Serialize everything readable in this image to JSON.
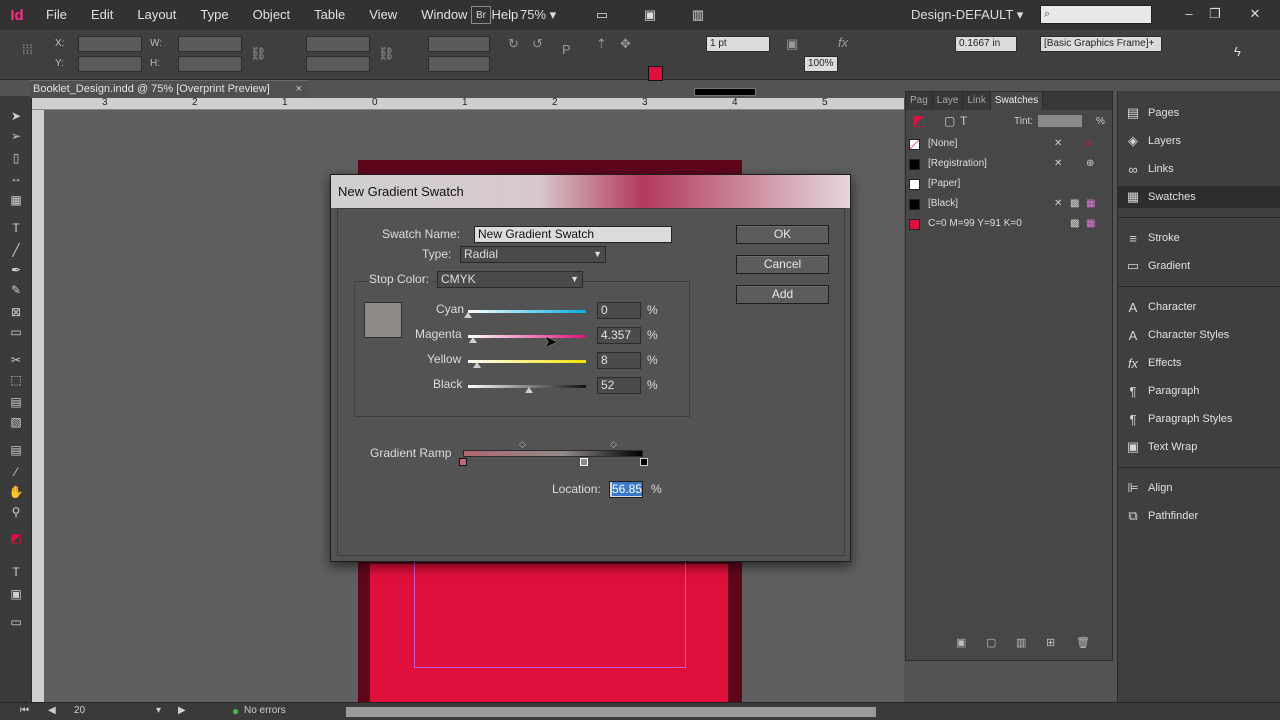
{
  "menubar": {
    "app_logo": "Id",
    "menus": [
      "File",
      "Edit",
      "Layout",
      "Type",
      "Object",
      "Table",
      "View",
      "Window",
      "Help"
    ],
    "bridge_label": "Br",
    "zoom": "75%",
    "workspace": "Design-DEFAULT"
  },
  "controlbar": {
    "x_label": "X:",
    "y_label": "Y:",
    "w_label": "W:",
    "h_label": "H:",
    "stroke_weight": "1 pt",
    "offset_value": "0.1667 in",
    "frame_style": "[Basic Graphics Frame]+",
    "opacity": "100%",
    "fill_color": "#e0103c"
  },
  "document": {
    "tab_title": "Booklet_Design.indd @ 75% [Overprint Preview]",
    "tab_close": "×",
    "ruler_numbers": [
      "3",
      "2",
      "1",
      "0",
      "1",
      "2",
      "3",
      "4",
      "5"
    ]
  },
  "statusbar": {
    "page_number": "20",
    "preflight": "No errors"
  },
  "swatches_panel": {
    "tabs": [
      "Pag",
      "Laye",
      "Link",
      "Swatches"
    ],
    "tint_label": "Tint:",
    "tint_pct": "%",
    "swatches": [
      {
        "name": "[None]",
        "color": "#ffffff"
      },
      {
        "name": "[Registration]",
        "color": "#000000"
      },
      {
        "name": "[Paper]",
        "color": "#ffffff"
      },
      {
        "name": "[Black]",
        "color": "#000000"
      },
      {
        "name": "C=0 M=99 Y=91 K=0",
        "color": "#e0103c"
      }
    ]
  },
  "dock": {
    "items": [
      {
        "label": "Pages",
        "icon": "pages-icon",
        "glyph": "▤"
      },
      {
        "label": "Layers",
        "icon": "layers-icon",
        "glyph": "◈"
      },
      {
        "label": "Links",
        "icon": "links-icon",
        "glyph": "∞"
      },
      {
        "label": "Swatches",
        "icon": "swatches-icon",
        "glyph": "▦"
      },
      {
        "label": "Stroke",
        "icon": "stroke-icon",
        "glyph": "≡"
      },
      {
        "label": "Gradient",
        "icon": "gradient-icon",
        "glyph": "▭"
      },
      {
        "label": "Character",
        "icon": "character-icon",
        "glyph": "A"
      },
      {
        "label": "Character Styles",
        "icon": "character-styles-icon",
        "glyph": "A"
      },
      {
        "label": "Effects",
        "icon": "effects-icon",
        "glyph": "fx"
      },
      {
        "label": "Paragraph",
        "icon": "paragraph-icon",
        "glyph": "¶"
      },
      {
        "label": "Paragraph Styles",
        "icon": "paragraph-styles-icon",
        "glyph": "¶"
      },
      {
        "label": "Text Wrap",
        "icon": "text-wrap-icon",
        "glyph": "▣"
      },
      {
        "label": "Align",
        "icon": "align-icon",
        "glyph": "⊫"
      },
      {
        "label": "Pathfinder",
        "icon": "pathfinder-icon",
        "glyph": "⧉"
      }
    ]
  },
  "dialog": {
    "title": "New Gradient Swatch",
    "swatch_name_label": "Swatch Name:",
    "swatch_name_value": "New Gradient Swatch",
    "type_label": "Type:",
    "type_value": "Radial",
    "stop_color_label": "Stop Color:",
    "stop_color_value": "CMYK",
    "preview_color": "#8f8b89",
    "channels": [
      {
        "label": "Cyan",
        "value": "0",
        "unit": "%",
        "level": 0
      },
      {
        "label": "Magenta",
        "value": "4.357",
        "unit": "%",
        "level": 0.04357
      },
      {
        "label": "Yellow",
        "value": "8",
        "unit": "%",
        "level": 0.08
      },
      {
        "label": "Black",
        "value": "52",
        "unit": "%",
        "level": 0.52
      }
    ],
    "ramp_label": "Gradient Ramp",
    "location_label": "Location:",
    "location_value": "56.85",
    "location_unit": "%",
    "buttons": {
      "ok": "OK",
      "cancel": "Cancel",
      "add": "Add"
    }
  }
}
